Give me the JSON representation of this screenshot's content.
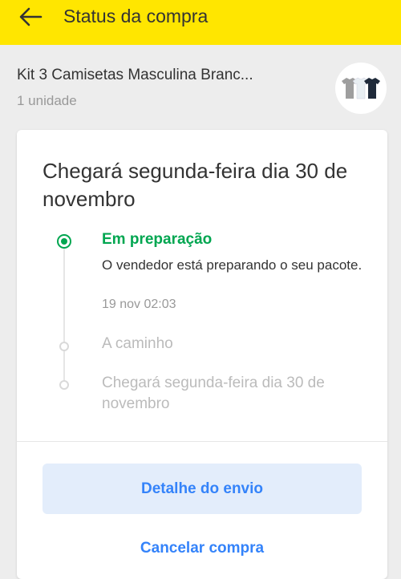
{
  "header": {
    "title": "Status da compra",
    "back_icon": "arrow-left-icon",
    "background": "#ffe600"
  },
  "product": {
    "name": "Kit 3 Camisetas Masculina Branc...",
    "quantity": "1 unidade",
    "thumbnail_icon": "tshirts-icon"
  },
  "shipment": {
    "title": "Chegará segunda-feira dia 30 de novembro",
    "steps": [
      {
        "label": "Em preparação",
        "description": "O vendedor está preparando o seu pacote.",
        "date": "19 nov 02:03",
        "state": "active"
      },
      {
        "label": "A caminho",
        "state": "pending"
      },
      {
        "label": "Chegará segunda-feira dia 30 de novembro",
        "state": "pending"
      }
    ]
  },
  "actions": {
    "detail_label": "Detalhe do envio",
    "cancel_label": "Cancelar compra"
  },
  "colors": {
    "accent": "#3483fa",
    "success": "#00a650",
    "brand": "#ffe600"
  }
}
